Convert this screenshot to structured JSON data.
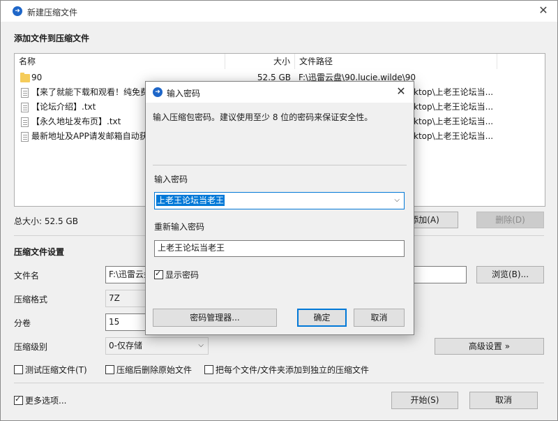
{
  "window": {
    "title": "新建压缩文件",
    "close_icon": "close-icon"
  },
  "main": {
    "add_files_heading": "添加文件到压缩文件",
    "columns": {
      "name": "名称",
      "size": "大小",
      "path": "文件路径"
    },
    "files": [
      {
        "name": "90",
        "size": "52.5 GB",
        "path": "F:\\迅雷云盘\\90.lucie.wilde\\90",
        "icon": "folder-icon"
      },
      {
        "name": "【来了就能下载和观看！纯免费",
        "size": "",
        "path": "ktop\\上老王论坛当...",
        "icon": "file-icon"
      },
      {
        "name": "【论坛介绍】.txt",
        "size": "",
        "path": "ktop\\上老王论坛当...",
        "icon": "file-icon"
      },
      {
        "name": "【永久地址发布页】.txt",
        "size": "",
        "path": "ktop\\上老王论坛当...",
        "icon": "file-icon"
      },
      {
        "name": "最新地址及APP请发邮箱自动获",
        "size": "",
        "path": "ktop\\上老王论坛当...",
        "icon": "file-icon"
      }
    ],
    "total_size": "总大小: 52.5 GB",
    "add_button": "添加(A)",
    "delete_button": "删除(D)",
    "settings_heading": "压缩文件设置",
    "filename_label": "文件名",
    "filename_value": "F:\\迅雷云盘",
    "browse_button": "浏览(B)...",
    "format_label": "压缩格式",
    "format_value": "7Z",
    "volume_label": "分卷",
    "volume_value": "15",
    "level_label": "压缩级别",
    "level_value": "0-仅存储",
    "advanced_button": "高级设置 »",
    "test_checkbox": "测试压缩文件(T)",
    "delete_after_checkbox": "压缩后删除原始文件",
    "separate_checkbox": "把每个文件/文件夹添加到独立的压缩文件",
    "more_options_checkbox": "更多选项...",
    "start_button": "开始(S)",
    "cancel_button": "取消"
  },
  "dialog": {
    "title": "输入密码",
    "instruction": "输入压缩包密码。建议使用至少 8 位的密码来保证安全性。",
    "password_label": "输入密码",
    "password_value": "上老王论坛当老王",
    "reenter_label": "重新输入密码",
    "reenter_value": "上老王论坛当老王",
    "show_password": "显示密码",
    "manager_button": "密码管理器...",
    "ok_button": "确定",
    "cancel_button": "取消"
  },
  "colors": {
    "accent": "#1e66c8",
    "selection": "#0078d7",
    "focus_border": "#0078d7"
  }
}
